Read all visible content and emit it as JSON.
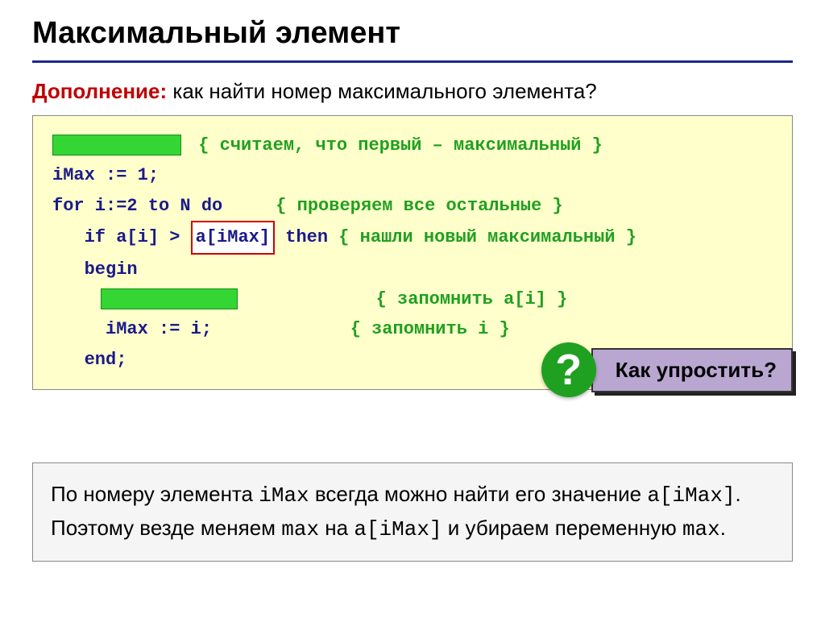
{
  "title": "Максимальный элемент",
  "subtitle": {
    "label": "Дополнение:",
    "text": " как найти номер максимального элемента?"
  },
  "code": {
    "c1": "{ считаем, что первый – максимальный }",
    "l2": "iMax := 1;",
    "l3a": "for i:=2 to N do",
    "c3": "{ проверяем все остальные }",
    "l4a": "   if a[i] > ",
    "l4box": "a[iMax]",
    "l4b": " then ",
    "c4": "{ нашли новый максимальный }",
    "l5": "   begin",
    "c6": "{ запомнить a[i] }",
    "l7": "     iMax := i;",
    "c7": "{ запомнить i }",
    "l8": "   end;"
  },
  "callout": {
    "mark": "?",
    "text": "Как упростить?"
  },
  "footer": {
    "p1a": "По номеру элемента ",
    "p1b": "iMax",
    "p1c": " всегда можно найти его значение ",
    "p1d": "a[iMax]",
    "p1e": ". Поэтому везде меняем ",
    "p1f": "max",
    "p1g": " на ",
    "p1h": "a[iMax]",
    "p1i": " и убираем переменную ",
    "p1j": "max",
    "p1k": "."
  }
}
